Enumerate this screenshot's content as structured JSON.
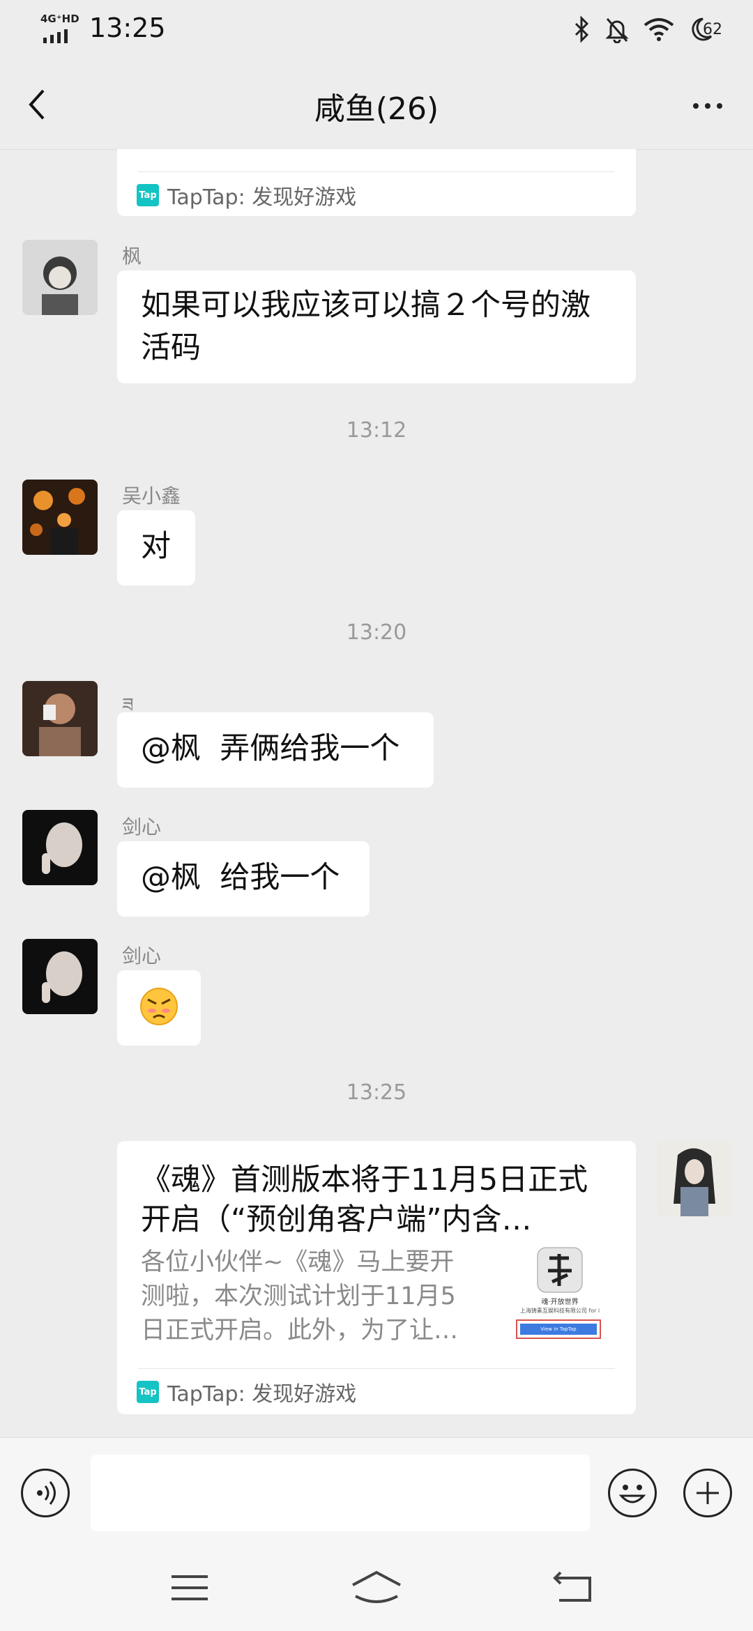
{
  "status_bar": {
    "network": "4G⁺HD",
    "time": "13:25",
    "battery": "62"
  },
  "header": {
    "title": "咸鱼(26)"
  },
  "messages": {
    "m0": {
      "source": "TapTap: 发现好游戏"
    },
    "m1": {
      "sender": "枫",
      "text_line1": "如果可以我应该可以搞２个号的激",
      "text_line2": "活码"
    },
    "ts1": "13:12",
    "m2": {
      "sender": "吴小鑫",
      "text": "对"
    },
    "ts2": "13:20",
    "m3": {
      "sender": "ཟ",
      "text": "@枫  弄俩给我一个"
    },
    "m4": {
      "sender": "剑心",
      "text": "@枫  给我一个"
    },
    "m5": {
      "sender": "剑心",
      "emoji": "😡"
    },
    "ts3": "13:25",
    "m6": {
      "title_line1": "《魂》首测版本将于11月5日正式",
      "title_line2": "开启（“预创角客户端”内含…",
      "desc_line1": "各位小伙伴~《魂》马上要开",
      "desc_line2": "测啦，本次测试计划于11月5",
      "desc_line3": "日正式开启。此外，为了让…",
      "thumb_line1": "魂·开放世界",
      "thumb_line2": "上海铸素互娱科技有限公司 for i",
      "thumb_button": "View in TapTap",
      "source": "TapTap: 发现好游戏"
    }
  },
  "colors": {
    "background": "#ededed",
    "bubble": "#ffffff",
    "taptap": "#14c3c3"
  }
}
